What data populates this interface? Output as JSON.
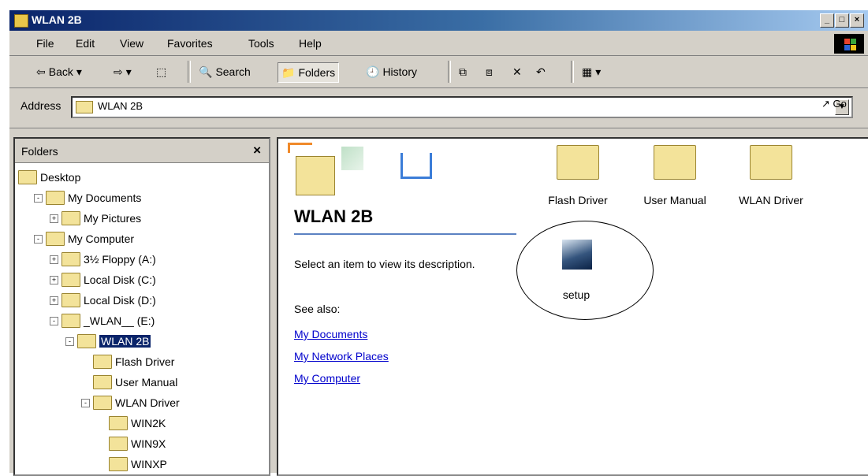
{
  "window": {
    "title": "WLAN 2B",
    "buttons": [
      "_",
      "□",
      "×"
    ]
  },
  "menu": [
    "File",
    "Edit",
    "View",
    "Favorites",
    "Tools",
    "Help"
  ],
  "toolbar": {
    "back": "Back",
    "search": "Search",
    "folders": "Folders",
    "history": "History"
  },
  "address": {
    "label": "Address",
    "value": "WLAN 2B",
    "go": "Go"
  },
  "folders_pane": {
    "title": "Folders",
    "close": "×",
    "tree": [
      {
        "label": "Desktop",
        "level": 0,
        "expander": ""
      },
      {
        "label": "My Documents",
        "level": 1,
        "expander": "-"
      },
      {
        "label": "My Pictures",
        "level": 2,
        "expander": "+"
      },
      {
        "label": "My Computer",
        "level": 1,
        "expander": "-"
      },
      {
        "label": "3½ Floppy (A:)",
        "level": 2,
        "expander": "+"
      },
      {
        "label": "Local Disk (C:)",
        "level": 2,
        "expander": "+"
      },
      {
        "label": "Local Disk (D:)",
        "level": 2,
        "expander": "+"
      },
      {
        "label": "_WLAN__ (E:)",
        "level": 2,
        "expander": "-"
      },
      {
        "label": "WLAN 2B",
        "level": 3,
        "expander": "-",
        "selected": true
      },
      {
        "label": "Flash Driver",
        "level": 4,
        "expander": ""
      },
      {
        "label": "User Manual",
        "level": 4,
        "expander": ""
      },
      {
        "label": "WLAN Driver",
        "level": 4,
        "expander": "-"
      },
      {
        "label": "WIN2K",
        "level": 5,
        "expander": ""
      },
      {
        "label": "WIN9X",
        "level": 5,
        "expander": ""
      },
      {
        "label": "WINXP",
        "level": 5,
        "expander": ""
      }
    ]
  },
  "content": {
    "heading": "WLAN 2B",
    "description": "Select an item to view its description.",
    "see_also": "See also:",
    "links": [
      "My Documents",
      "My Network Places",
      "My Computer"
    ],
    "items": [
      {
        "label": "Flash Driver",
        "icon": "folder-icon"
      },
      {
        "label": "User Manual",
        "icon": "folder-icon"
      },
      {
        "label": "WLAN Driver",
        "icon": "folder-icon"
      },
      {
        "label": "setup",
        "icon": "setup-icon"
      }
    ]
  }
}
